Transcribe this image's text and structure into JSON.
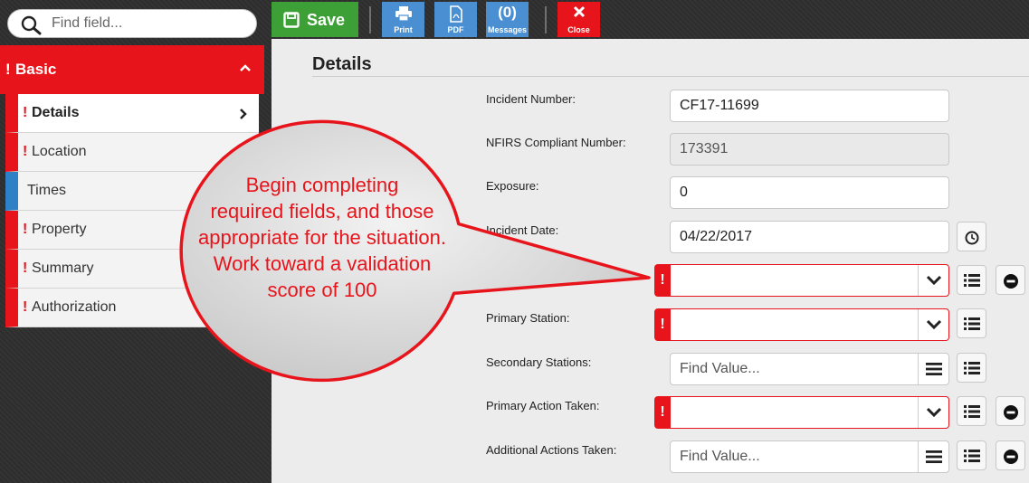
{
  "sidebar": {
    "search_placeholder": "Find field...",
    "section": {
      "bang": "!",
      "title": "Basic"
    },
    "items": [
      {
        "label": "Details",
        "bang": "!"
      },
      {
        "label": "Location",
        "bang": "!"
      },
      {
        "label": "Times",
        "bang": ""
      },
      {
        "label": "Property",
        "bang": "!"
      },
      {
        "label": "Summary",
        "bang": "!"
      },
      {
        "label": "Authorization",
        "bang": "!"
      }
    ]
  },
  "toolbar": {
    "save_label": "Save",
    "print_label": "Print",
    "pdf_label": "PDF",
    "messages_count": "(0)",
    "messages_label": "Messages",
    "close_label": "Close"
  },
  "main": {
    "title": "Details",
    "fields": {
      "incident_number": {
        "label": "Incident Number:",
        "value": "CF17-11699"
      },
      "nfirs_number": {
        "label": "NFIRS Compliant Number:",
        "value": "173391"
      },
      "exposure": {
        "label": "Exposure:",
        "value": "0"
      },
      "incident_date": {
        "label": "Incident Date:",
        "value": "04/22/2017"
      },
      "primary_station": {
        "label": "Primary Station:"
      },
      "secondary_stations": {
        "label": "Secondary Stations:",
        "placeholder": "Find Value..."
      },
      "primary_action": {
        "label": "Primary Action Taken:"
      },
      "additional_actions": {
        "label": "Additional Actions Taken:",
        "placeholder": "Find Value..."
      }
    },
    "required_flag": "!"
  },
  "callout": {
    "lines": [
      "Begin completing",
      "required fields, and those",
      "appropriate for the situation.",
      "Work toward a validation",
      "score of 100"
    ]
  },
  "colors": {
    "accent_red": "#e8141b",
    "save_green": "#3da036",
    "toolbar_blue": "#4a8fd2",
    "times_blue": "#2f81c5"
  }
}
